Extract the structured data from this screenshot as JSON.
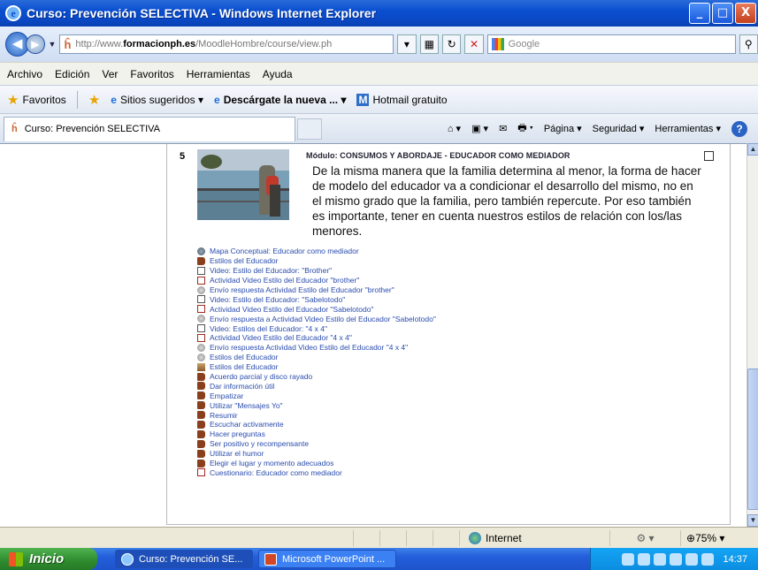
{
  "window": {
    "title": "Curso: Prevención SELECTIVA - Windows Internet Explorer",
    "buttons": {
      "minimize": "_",
      "maximize": "□",
      "close": "X"
    }
  },
  "address_bar": {
    "url_prefix": "http://www.",
    "url_host": "formacionph.es",
    "url_path": "/MoodleHombre/course/view.ph",
    "search_placeholder": "Google"
  },
  "menu": [
    "Archivo",
    "Edición",
    "Ver",
    "Favoritos",
    "Herramientas",
    "Ayuda"
  ],
  "favorites_bar": {
    "favorites_label": "Favoritos",
    "items": [
      "Sitios sugeridos ▾",
      "Descárgate la nueva ... ▾",
      "Hotmail gratuito"
    ]
  },
  "tab": {
    "label": "Curso: Prevención SELECTIVA"
  },
  "commands": [
    "Página ▾",
    "Seguridad ▾",
    "Herramientas ▾"
  ],
  "section": {
    "number": "5",
    "module_title": "Módulo: CONSUMOS Y ABORDAJE - EDUCADOR COMO MEDIADOR",
    "summary": "De la misma manera que la familia determina al menor, la forma de hacer de modelo del educador va a condicionar el desarrollo del mismo, no en el mismo grado que la familia, pero también repercute. Por eso también es importante, tener en cuenta nuestros estilos de relación con los/las menores.",
    "activities": [
      {
        "icon": "map",
        "label": "Mapa Conceptual: Educador como mediador"
      },
      {
        "icon": "book",
        "label": "Estilos del Educador"
      },
      {
        "icon": "doc",
        "label": "Video: Estilo del Educador: \"Brother\""
      },
      {
        "icon": "assign",
        "label": "Actividad Video Estilo del Educador \"brother\""
      },
      {
        "icon": "upload",
        "label": "Envío respuesta Actividad Estilo del Educador \"brother\""
      },
      {
        "icon": "doc",
        "label": "Video: Estilo del Educador: \"Sabelotodo\""
      },
      {
        "icon": "assign",
        "label": "Actividad Video Estilo del Educador \"Sabelotodo\""
      },
      {
        "icon": "upload",
        "label": "Envío respuesta a Actividad Video Estilo del Educador \"Sabelotodo\""
      },
      {
        "icon": "doc",
        "label": "Video: Estilos del Educador: \"4 x 4\""
      },
      {
        "icon": "assign",
        "label": "Actividad Video Estilo del Educador \"4 x 4\""
      },
      {
        "icon": "upload",
        "label": "Envío respuesta Actividad Video Estilo del Educador \"4 x 4\""
      },
      {
        "icon": "upload",
        "label": "Estilos del Educador"
      },
      {
        "icon": "person",
        "label": "Estilos del Educador"
      },
      {
        "icon": "book",
        "label": "Acuerdo parcial y disco rayado"
      },
      {
        "icon": "book",
        "label": "Dar información útil"
      },
      {
        "icon": "book",
        "label": "Empatizar"
      },
      {
        "icon": "book",
        "label": "Utilizar \"Mensajes Yo\""
      },
      {
        "icon": "book",
        "label": "Resumir"
      },
      {
        "icon": "book",
        "label": "Escuchar activamente"
      },
      {
        "icon": "book",
        "label": "Hacer preguntas"
      },
      {
        "icon": "book",
        "label": "Ser positivo y recompensante"
      },
      {
        "icon": "book",
        "label": "Utilizar el humor"
      },
      {
        "icon": "book",
        "label": "Elegir el lugar y momento adecuados"
      },
      {
        "icon": "quiz",
        "label": "Cuestionario: Educador como mediador"
      }
    ]
  },
  "status_bar": {
    "zone": "Internet",
    "zoom": "75%"
  },
  "taskbar": {
    "start_label": "Inicio",
    "tasks": [
      "Curso: Prevención SE...",
      "Microsoft PowerPoint ..."
    ],
    "clock": "14:37"
  }
}
